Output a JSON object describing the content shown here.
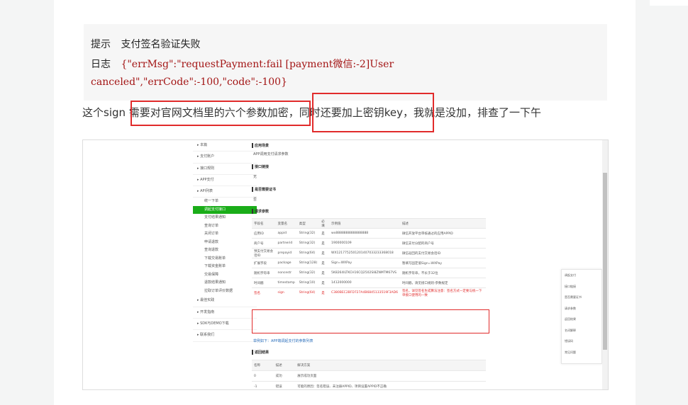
{
  "code": {
    "line1_label": "提示",
    "line1_value": "支付签名验证失败",
    "line2_label": "日志",
    "line2_value": "{\"errMsg\":\"requestPayment:fail [payment微信:-2]User",
    "line3_value": "canceled\",\"errCode\":-100,\"code\":-100}"
  },
  "paragraph": "这个sign 需要对官网文档里的六个参数加密，同时还要加上密钥key，我就是没加，排查了一下午",
  "highlight_color": "#e12b2b",
  "screenshot": {
    "nav": [
      {
        "label": "本篇",
        "sel": false,
        "sub": false
      },
      {
        "label": "支付账户",
        "sel": false,
        "sub": false
      },
      {
        "label": "接口规则",
        "sel": false,
        "sub": false
      },
      {
        "label": "APP支付",
        "sel": false,
        "sub": false
      },
      {
        "label": "API列表",
        "sel": false,
        "sub": false
      },
      {
        "label": "统一下单",
        "sel": false,
        "sub": true
      },
      {
        "label": "调起支付接口",
        "sel": true,
        "sub": true
      },
      {
        "label": "支付结果通知",
        "sel": false,
        "sub": true
      },
      {
        "label": "查询订单",
        "sel": false,
        "sub": true
      },
      {
        "label": "关闭订单",
        "sel": false,
        "sub": true
      },
      {
        "label": "申请退款",
        "sel": false,
        "sub": true
      },
      {
        "label": "查询退款",
        "sel": false,
        "sub": true
      },
      {
        "label": "下载交易账单",
        "sel": false,
        "sub": true
      },
      {
        "label": "下载资金账单",
        "sel": false,
        "sub": true
      },
      {
        "label": "交易保障",
        "sel": false,
        "sub": true
      },
      {
        "label": "退款结果通知",
        "sel": false,
        "sub": true
      },
      {
        "label": "拉取订单评价数据",
        "sel": false,
        "sub": true
      },
      {
        "label": "最佳实践",
        "sel": false,
        "sub": false
      },
      {
        "label": "开发指南",
        "sel": false,
        "sub": false
      },
      {
        "label": "SDK与DEMO下载",
        "sel": false,
        "sub": false
      },
      {
        "label": "联系我们",
        "sel": false,
        "sub": false
      }
    ],
    "doc": {
      "h1": "应用场景",
      "t1": "APP调用支付请求参数",
      "h2": "接口链接",
      "t2": "无",
      "h3": "是否需要证书",
      "t3": "否",
      "h4": "请求参数",
      "example": "举例如下：APP端调起支付的参数列表",
      "h5": "返回结果"
    },
    "param_headers": [
      "字段名",
      "变量名",
      "类型",
      "必填",
      "示例值",
      "描述"
    ],
    "params": [
      [
        "应用ID",
        "appid",
        "String(32)",
        "是",
        "wx8888888888888888",
        "微信开放平台审核通过的应用APPID"
      ],
      [
        "商户号",
        "partnerid",
        "String(32)",
        "是",
        "1900000109",
        "微信支付分配的商户号"
      ],
      [
        "预支付交易会话ID",
        "prepayid",
        "String(64)",
        "是",
        "WX1217752501201407033233368018",
        "微信返回的支付交易会话ID"
      ],
      [
        "扩展字段",
        "package",
        "String(128)",
        "是",
        "Sign=WXPay",
        "暂填写固定值Sign=WXPay"
      ],
      [
        "随机字符串",
        "noncestr",
        "String(32)",
        "是",
        "5K8264ILTKCH16CQ2502SI8ZNMTM67VS",
        "随机字符串，不长于32位"
      ],
      [
        "时间戳",
        "timestamp",
        "String(10)",
        "是",
        "1412000000",
        "时间戳，请见接口规则-参数规定"
      ],
      [
        "签名",
        "sign",
        "String(64)",
        "是",
        "C380BEC2BFD727A4B6845133519F3AD6",
        "签名，详见签名生成算法注意：签名方式一定要与统一下单接口使用的一致"
      ]
    ],
    "result_headers": [
      "名称",
      "描述",
      "解决方案"
    ],
    "results": [
      [
        "0",
        "成功",
        "展示成功页面"
      ],
      [
        "-1",
        "错误",
        "可能的原因：签名错误、未注册APPID、项目设置APPID不正确"
      ]
    ],
    "toc": [
      "调起支付",
      "接口链接",
      "是否需要证书",
      "请求参数",
      "返回结果",
      "名词解释",
      "错误码",
      "常见问题"
    ]
  }
}
